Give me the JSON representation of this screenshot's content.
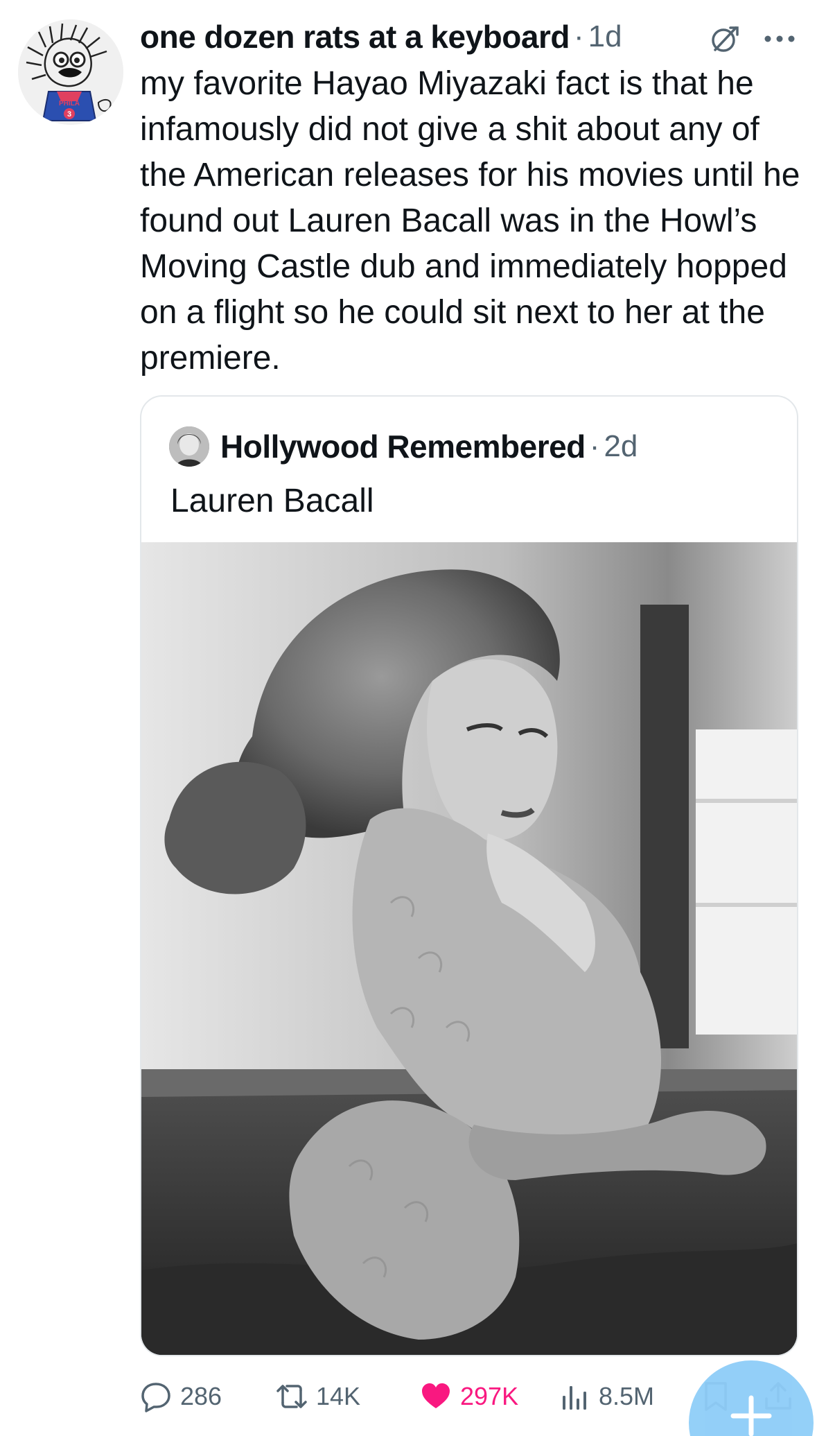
{
  "post": {
    "author": {
      "display_name": "one dozen rats at a keyboard",
      "avatar_icon": "cartoon-avatar"
    },
    "separator": "·",
    "timestamp": "1d",
    "header_icons": [
      "grok-icon",
      "more-icon"
    ],
    "text": "my favorite Hayao Miyazaki fact is that he infamously did not give a shit about any of the American releases for his movies until he found out Lauren Bacall was in the Howl’s Moving Castle dub and immediately hopped on a flight so he could sit next to her at the premiere."
  },
  "quoted_post": {
    "author": "Hollywood Remembered",
    "separator": "·",
    "timestamp": "2d",
    "text": "Lauren Bacall",
    "media": "black-and-white-portrait-photo"
  },
  "actions": {
    "replies": "286",
    "reposts": "14K",
    "likes": "297K",
    "views": "8.5M"
  },
  "colors": {
    "text": "#0f1419",
    "muted": "#536471",
    "like": "#f91880",
    "accent": "#1d9bf0",
    "fab": "#8ecdf8",
    "card_border": "#e3e7ea"
  }
}
